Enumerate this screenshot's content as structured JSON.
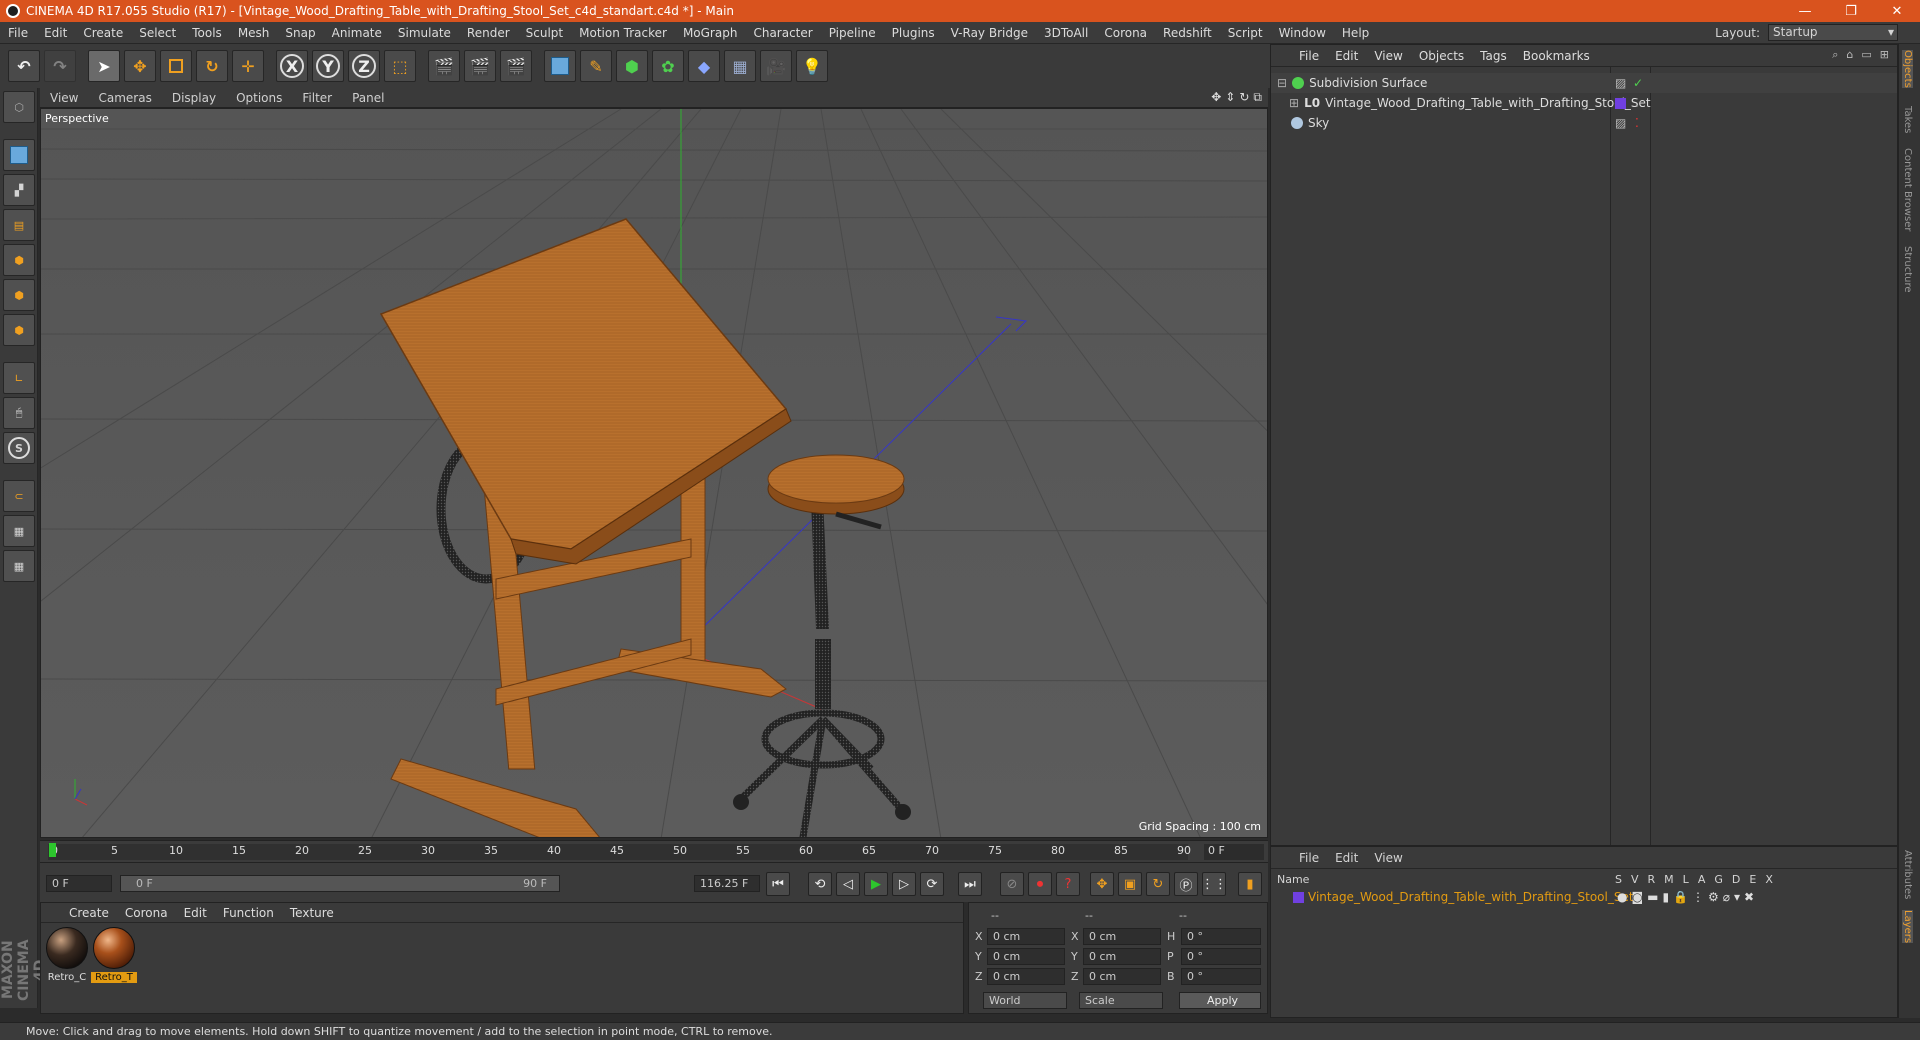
{
  "titlebar": {
    "title": "CINEMA 4D R17.055 Studio (R17) - [Vintage_Wood_Drafting_Table_with_Drafting_Stool_Set_c4d_standart.c4d *] - Main",
    "minimize": "—",
    "restore": "❐",
    "close": "✕"
  },
  "menubar": {
    "items": [
      "File",
      "Edit",
      "Create",
      "Select",
      "Tools",
      "Mesh",
      "Snap",
      "Animate",
      "Simulate",
      "Render",
      "Sculpt",
      "Motion Tracker",
      "MoGraph",
      "Character",
      "Pipeline",
      "Plugins",
      "V-Ray Bridge",
      "3DToAll",
      "Corona",
      "Redshift",
      "Script",
      "Window",
      "Help"
    ],
    "layout_label": "Layout:",
    "layout_value": "Startup"
  },
  "toolbar": {
    "axis_x": "X",
    "axis_y": "Y",
    "axis_z": "Z"
  },
  "viewport": {
    "menu": [
      "View",
      "Cameras",
      "Display",
      "Options",
      "Filter",
      "Panel"
    ],
    "label": "Perspective",
    "grid_spacing": "Grid Spacing : 100 cm"
  },
  "timeline": {
    "ticks": [
      "0",
      "5",
      "10",
      "15",
      "20",
      "25",
      "30",
      "35",
      "40",
      "45",
      "50",
      "55",
      "60",
      "65",
      "70",
      "75",
      "80",
      "85",
      "90"
    ],
    "frame_end": "0 F",
    "current_frame": "0 F",
    "range_start": "0 F",
    "range_end": "90 F",
    "fps_field": "116.25 F"
  },
  "materials": {
    "menu": [
      "Create",
      "Corona",
      "Edit",
      "Function",
      "Texture"
    ],
    "items": [
      {
        "label": "Retro_C",
        "selected": false
      },
      {
        "label": "Retro_T",
        "selected": true
      }
    ]
  },
  "coordinates": {
    "headers": [
      "--",
      "--",
      "--"
    ],
    "rows": [
      {
        "a": "X",
        "a_val": "0 cm",
        "b": "X",
        "b_val": "0 cm",
        "c": "H",
        "c_val": "0 °"
      },
      {
        "a": "Y",
        "a_val": "0 cm",
        "b": "Y",
        "b_val": "0 cm",
        "c": "P",
        "c_val": "0 °"
      },
      {
        "a": "Z",
        "a_val": "0 cm",
        "b": "Z",
        "b_val": "0 cm",
        "c": "B",
        "c_val": "0 °"
      }
    ],
    "world": "World",
    "scale": "Scale",
    "apply": "Apply"
  },
  "objects": {
    "menu": [
      "File",
      "Edit",
      "View",
      "Objects",
      "Tags",
      "Bookmarks"
    ],
    "items": [
      {
        "name": "Subdivision Surface",
        "color": "#8ed08e"
      },
      {
        "name": "Vintage_Wood_Drafting_Table_with_Drafting_Stool_Set",
        "color": "#cccccc"
      },
      {
        "name": "Sky",
        "color": "#cccccc"
      }
    ]
  },
  "layers": {
    "menu": [
      "File",
      "Edit",
      "View"
    ],
    "name_header": "Name",
    "columns": [
      "S",
      "V",
      "R",
      "M",
      "L",
      "A",
      "G",
      "D",
      "E",
      "X"
    ],
    "row_name": "Vintage_Wood_Drafting_Table_with_Drafting_Stool_Set"
  },
  "sidetabs": [
    "Objects",
    "Takes",
    "Content Browser",
    "Structure",
    "Attributes",
    "Layers"
  ],
  "maxon": "MAXON CINEMA 4D",
  "status": "Move: Click and drag to move elements. Hold down SHIFT to quantize movement / add to the selection in point mode, CTRL to remove.",
  "colors": {
    "title_bar": "#d9531e",
    "accent": "#e39b11",
    "wood": "#b06a2a"
  }
}
